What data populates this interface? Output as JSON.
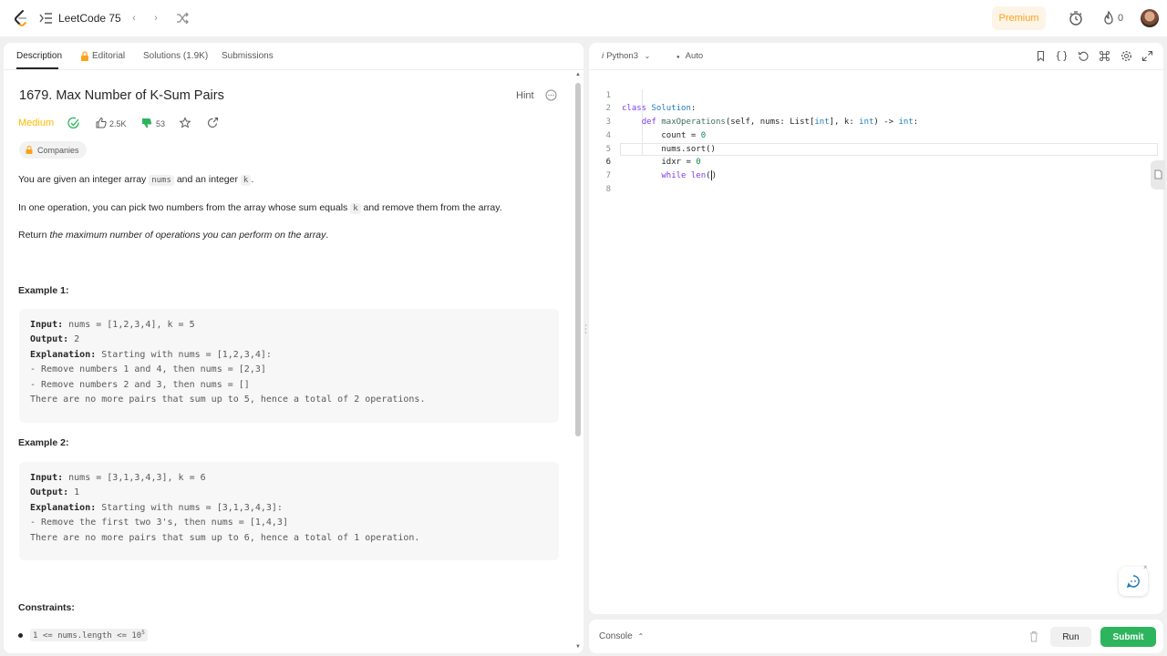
{
  "topbar": {
    "brand": "LeetCode 75",
    "premium_label": "Premium",
    "streak_count": "0"
  },
  "tabs": {
    "description": "Description",
    "editorial": "Editorial",
    "solutions": "Solutions (1.9K)",
    "submissions": "Submissions"
  },
  "problem": {
    "title": "1679. Max Number of K-Sum Pairs",
    "hint": "Hint",
    "difficulty": "Medium",
    "likes": "2.5K",
    "dislikes": "53",
    "companies": "Companies",
    "p1_a": "You are given an integer array ",
    "p1_code1": "nums",
    "p1_b": " and an integer ",
    "p1_code2": "k",
    "p1_c": ".",
    "p2_a": "In one operation, you can pick two numbers from the array whose sum equals ",
    "p2_code": "k",
    "p2_b": " and remove them from the array.",
    "p3_a": "Return ",
    "p3_b": "the maximum number of operations you can perform on the array",
    "p3_c": ".",
    "example1_title": "Example 1:",
    "example1": {
      "input_label": "Input:",
      "input": " nums = [1,2,3,4], k = 5",
      "output_label": "Output:",
      "output": " 2",
      "explanation_label": "Explanation:",
      "explanation": " Starting with nums = [1,2,3,4]:",
      "line4": "- Remove numbers 1 and 4, then nums = [2,3]",
      "line5": "- Remove numbers 2 and 3, then nums = []",
      "line6": "There are no more pairs that sum up to 5, hence a total of 2 operations."
    },
    "example2_title": "Example 2:",
    "example2": {
      "input_label": "Input:",
      "input": " nums = [3,1,3,4,3], k = 6",
      "output_label": "Output:",
      "output": " 1",
      "explanation_label": "Explanation:",
      "explanation": " Starting with nums = [3,1,3,4,3]:",
      "line4": "- Remove the first two 3's, then nums = [1,4,3]",
      "line5": "There are no more pairs that sum up to 6, hence a total of 1 operation."
    },
    "constraints_title": "Constraints:",
    "constraint1_base": "1 <= nums.length <= 10",
    "constraint1_exp": "5"
  },
  "editor": {
    "language": "Python3",
    "mode": "Auto",
    "line_numbers": [
      "1",
      "2",
      "3",
      "4",
      "5",
      "6",
      "7",
      "8"
    ],
    "code": {
      "l1_kw": "class",
      "l1_name": "Solution",
      "l1_end": ":",
      "l2_kw": "def",
      "l2_fn": "maxOperations",
      "l2_a": "(self, nums: List[",
      "l2_t1": "int",
      "l2_b": "], k: ",
      "l2_t2": "int",
      "l2_c": ") -> ",
      "l2_t3": "int",
      "l2_d": ":",
      "l3_a": "count = ",
      "l3_num": "0",
      "l4": "nums.sort()",
      "l5_a": "idxr = ",
      "l5_num": "0",
      "l6_kw": "while",
      "l6_fn": "len",
      "l6_a": "(",
      "l6_b": ")"
    }
  },
  "bottom": {
    "console": "Console",
    "run": "Run",
    "submit": "Submit"
  },
  "colors": {
    "accent_orange": "#ffa116",
    "medium": "#ffb800",
    "submit_green": "#2db55d"
  }
}
